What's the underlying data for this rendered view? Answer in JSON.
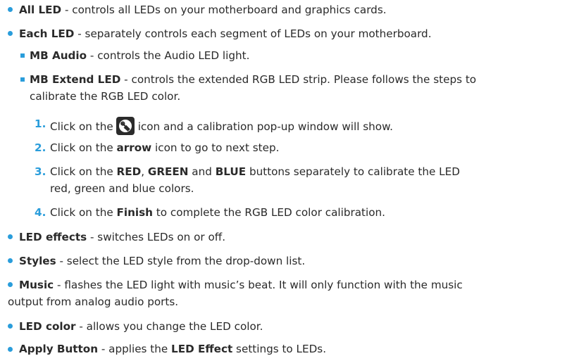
{
  "items": [
    {
      "label": "All LED",
      "desc": " - controls all LEDs on your motherboard and graphics cards."
    },
    {
      "label": "Each LED",
      "desc": " - separately controls each segment of LEDs on your motherboard."
    },
    {
      "label": "LED effects",
      "desc": " - switches LEDs on or off."
    },
    {
      "label": "Styles",
      "desc": " - select the LED style from the drop-down list."
    },
    {
      "label": "Music",
      "desc": " -  flashes the LED light with music’s beat. It will only function with the music",
      "desc2": "output from analog audio ports."
    },
    {
      "label": "LED color",
      "desc": " - allows you change the LED color."
    },
    {
      "label": "Apply Button",
      "desc_pre": " - applies the ",
      "bold2": "LED Effect",
      "desc_post": " settings to LEDs."
    }
  ],
  "subitems": [
    {
      "label": "MB Audio",
      "desc": " - controls the Audio LED light."
    },
    {
      "label": "MB Extend LED",
      "desc": " - controls the extended RGB LED strip. Please follows the steps to",
      "desc2": "calibrate the RGB LED color."
    }
  ],
  "steps": [
    {
      "num": "1.",
      "pre": "Click on the",
      "post": "icon and a calibration pop-up window will show."
    },
    {
      "num": "2.",
      "pre": "Click on the ",
      "bold": "arrow",
      "post": " icon to go to next step."
    },
    {
      "num": "3.",
      "pre": "Click on the ",
      "bold": "RED",
      "mid1": ", ",
      "bold2": "GREEN",
      "mid2": " and ",
      "bold3": "BLUE",
      "post": " buttons separately to calibrate the LED",
      "line2": "red, green and blue colors."
    },
    {
      "num": "4.",
      "pre": "Click on the ",
      "bold": "Finish",
      "post": " to complete the RGB LED color calibration."
    }
  ],
  "icons": {
    "calibration": "wrench-icon"
  },
  "colors": {
    "accent": "#2a9ddb",
    "text": "#2a2a2a"
  }
}
